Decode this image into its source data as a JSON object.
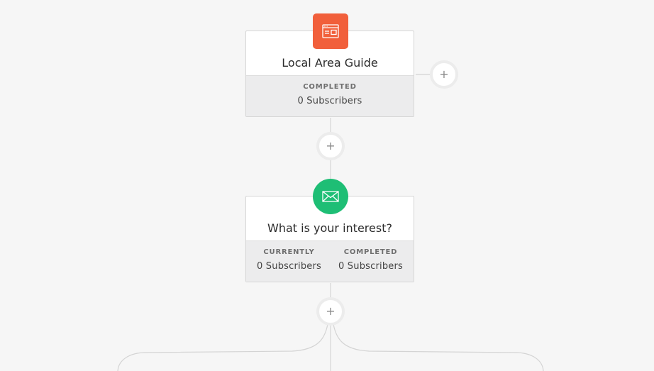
{
  "steps": [
    {
      "title": "Local Area Guide",
      "icon": "browser-window-icon",
      "color": "#f15f3b",
      "stats": [
        {
          "label": "COMPLETED",
          "value": "0 Subscribers"
        }
      ]
    },
    {
      "title": "What is your interest?",
      "icon": "envelope-icon",
      "color": "#1ebe75",
      "stats": [
        {
          "label": "CURRENTLY",
          "value": "0 Subscribers"
        },
        {
          "label": "COMPLETED",
          "value": "0 Subscribers"
        }
      ]
    }
  ],
  "add_button_symbol": "+"
}
